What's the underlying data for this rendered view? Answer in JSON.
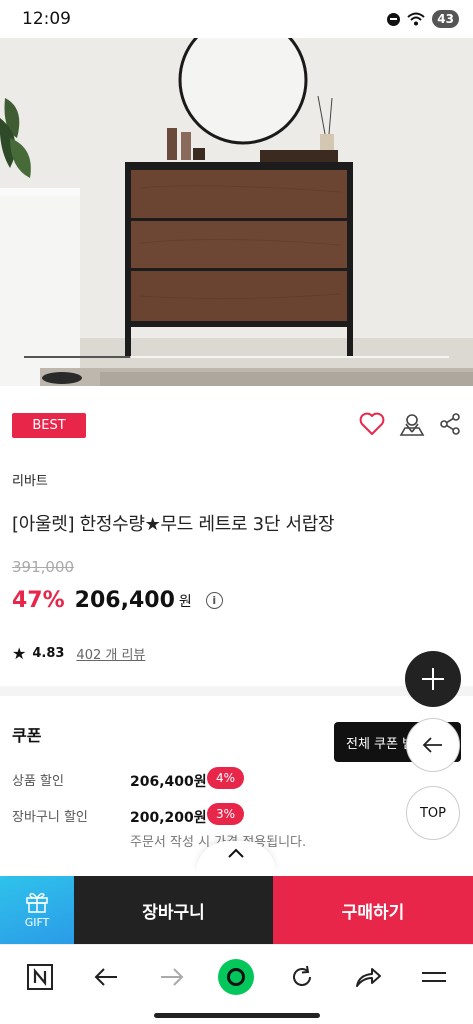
{
  "status_bar": {
    "time": "12:09",
    "battery": "43"
  },
  "product": {
    "badge": "BEST",
    "brand": "리바트",
    "title": "[아울렛] 한정수량★무드 레트로 3단 서랍장",
    "original_price": "391,000",
    "discount": "47%",
    "price": "206,400",
    "currency": "원",
    "rating": "4.83",
    "reviews": "402 개 리뷰",
    "image_progress": 0.25
  },
  "coupon": {
    "title": "쿠폰",
    "all_button": "전체 쿠폰 받기",
    "rows": [
      {
        "label": "상품 할인",
        "value": "206,400원",
        "badge": "4%"
      },
      {
        "label": "장바구니 할인",
        "value": "200,200원",
        "badge": "3%"
      }
    ],
    "note": "주문서 작성 시 가격 적용됩니다."
  },
  "floating": {
    "top_label": "TOP"
  },
  "bottom_bar": {
    "gift": "GIFT",
    "cart": "장바구니",
    "buy": "구매하기"
  },
  "colors": {
    "accent": "#e8264a",
    "dark": "#222222",
    "gift_blue": "#2fb6ea",
    "naver_green": "#03c75a"
  },
  "icons": [
    "heart-icon",
    "store-location-icon",
    "share-icon",
    "info-icon",
    "star-icon",
    "plus-icon",
    "back-arrow-icon",
    "chevron-up-icon",
    "gift-icon",
    "naver-n-icon",
    "forward-arrow-icon",
    "green-home-icon",
    "refresh-icon",
    "share-arrow-icon",
    "menu-icon"
  ]
}
